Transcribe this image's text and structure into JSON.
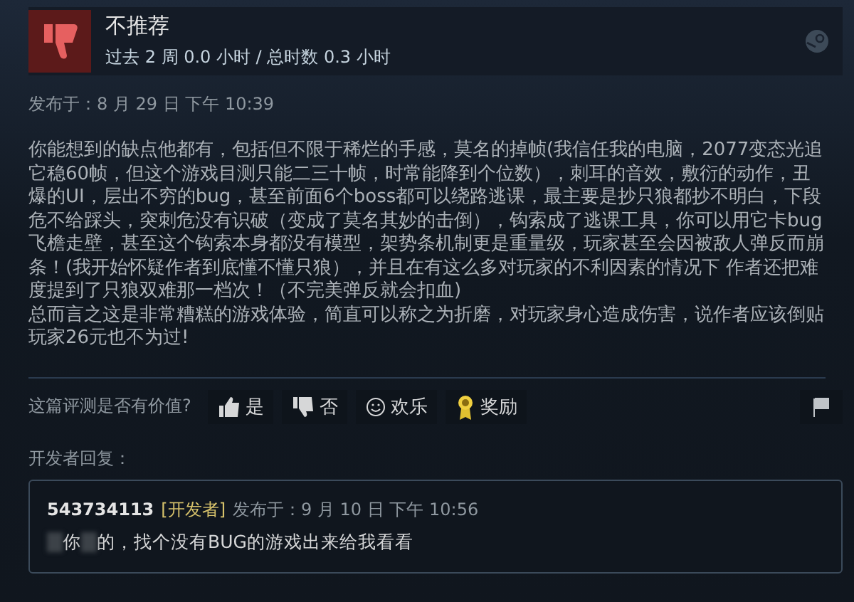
{
  "review": {
    "verdict": "不推荐",
    "recommended": false,
    "hours": "过去 2 周 0.0 小时 / 总时数 0.3 小时",
    "posted": "发布于：8 月 29 日 下午 10:39",
    "paragraphs": [
      "你能想到的缺点他都有，包括但不限于稀烂的手感，莫名的掉帧(我信任我的电脑，2077变态光追它稳60帧，但这个游戏目测只能二三十帧，时常能降到个位数），刺耳的音效，敷衍的动作，丑爆的UI，层出不穷的bug，甚至前面6个boss都可以绕路逃课，最主要是抄只狼都抄不明白，下段危不给踩头，突刺危没有识破（变成了莫名其妙的击倒），钩索成了逃课工具，你可以用它卡bug飞檐走壁，甚至这个钩索本身都没有模型，架势条机制更是重量级，玩家甚至会因被敌人弹反而崩条！(我开始怀疑作者到底懂不懂只狼），并且在有这么多对玩家的不利因素的情况下 作者还把难度提到了只狼双难那一档次！（不完美弹反就会扣血)",
      "总而言之这是非常糟糕的游戏体验，简直可以称之为折磨，对玩家身心造成伤害，说作者应该倒贴玩家26元也不为过!"
    ]
  },
  "helpful": {
    "prompt": "这篇评测是否有价值?",
    "buttons": [
      {
        "kind": "yes",
        "label": "是"
      },
      {
        "kind": "no",
        "label": "否"
      },
      {
        "kind": "funny",
        "label": "欢乐"
      },
      {
        "kind": "award",
        "label": "奖励"
      }
    ]
  },
  "developer_reply": {
    "heading": "开发者回复：",
    "author": "543734113",
    "badge": "[开发者]",
    "posted": "发布于：9 月 10 日 下午 10:56",
    "parts": [
      {
        "kind": "redacted"
      },
      {
        "kind": "text",
        "text": "你"
      },
      {
        "kind": "redacted"
      },
      {
        "kind": "text",
        "text": "的，找个没有BUG的游戏出来给我看看"
      }
    ]
  }
}
